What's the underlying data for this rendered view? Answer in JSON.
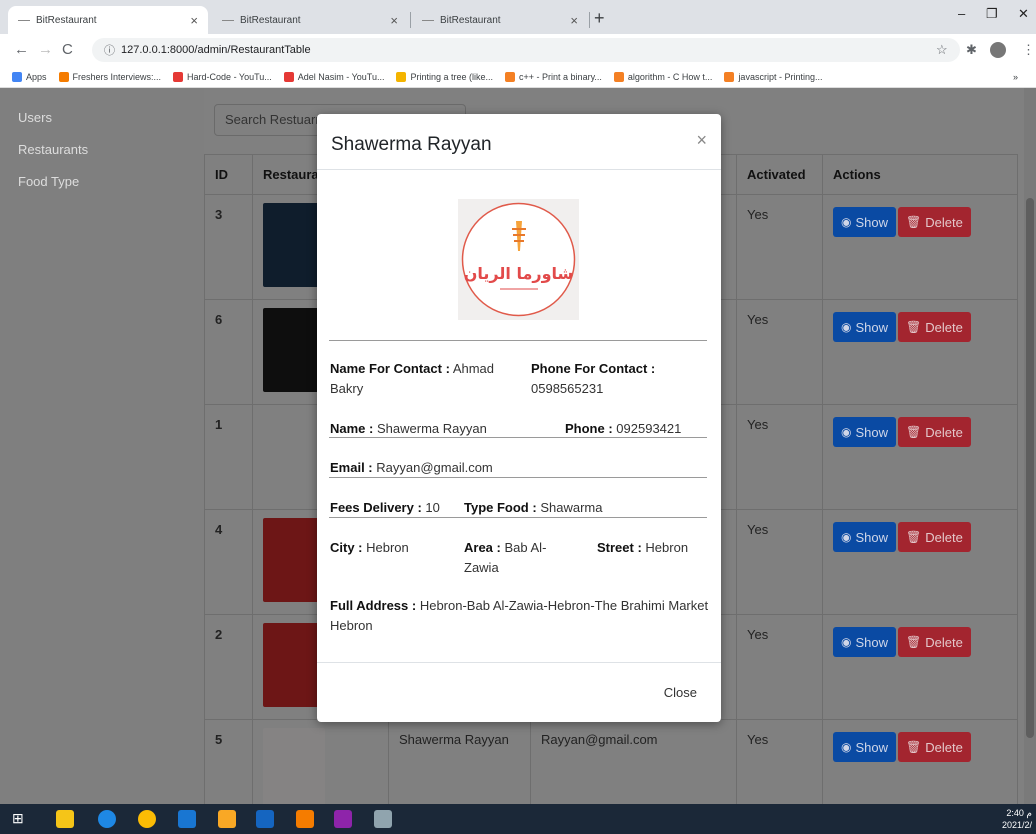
{
  "browser": {
    "tabs": [
      {
        "title": "BitRestaurant",
        "close": "×"
      },
      {
        "title": "BitRestaurant",
        "close": "×"
      },
      {
        "title": "BitRestaurant",
        "close": "×"
      }
    ],
    "new_tab": "+",
    "window_controls": {
      "minimize": "–",
      "restore": "❐",
      "close": "✕"
    },
    "url": "127.0.0.1:8000/admin/RestaurantTable",
    "bookmarks": [
      {
        "label": "Apps",
        "color": "#4285f4"
      },
      {
        "label": "Freshers Interviews:...",
        "color": "#f57c00"
      },
      {
        "label": "Hard-Code - YouTu...",
        "color": "#e53935"
      },
      {
        "label": "Adel Nasim - YouTu...",
        "color": "#e53935"
      },
      {
        "label": "Printing a tree (like...",
        "color": "#f4b400"
      },
      {
        "label": "c++ - Print a binary...",
        "color": "#f48024"
      },
      {
        "label": "algorithm - C How t...",
        "color": "#f48024"
      },
      {
        "label": "javascript - Printing...",
        "color": "#f48024"
      }
    ],
    "bookmarks_more": "»"
  },
  "sidebar": {
    "items": [
      {
        "label": "Users"
      },
      {
        "label": "Restaurants"
      },
      {
        "label": "Food Type"
      }
    ]
  },
  "main": {
    "search_placeholder": "Search Restuarn",
    "columns": [
      "ID",
      "Restaura",
      "Activated",
      "Actions"
    ],
    "rows": [
      {
        "id": "3",
        "activated": "Yes",
        "logo_color": "#1c3550",
        "name": "",
        "email": ""
      },
      {
        "id": "6",
        "activated": "Yes",
        "logo_color": "#1a1a1a",
        "name": "",
        "email": ""
      },
      {
        "id": "1",
        "activated": "Yes",
        "logo_color": "#e8e8e8",
        "name": "",
        "email": ""
      },
      {
        "id": "4",
        "activated": "Yes",
        "logo_color": "#c62828",
        "name": "",
        "email": ""
      },
      {
        "id": "2",
        "activated": "Yes",
        "logo_color": "#c62828",
        "name": "",
        "email": ""
      },
      {
        "id": "5",
        "activated": "Yes",
        "logo_color": "#f1efee",
        "name": "Shawerma Rayyan",
        "email": "Rayyan@gmail.com"
      }
    ],
    "show_label": "Show",
    "delete_label": "Delete"
  },
  "modal": {
    "title": "Shawerma Rayyan",
    "close_x": "×",
    "logo_text": "شاورما الريان",
    "fields": {
      "name_for_contact_label": "Name For Contact :",
      "name_for_contact_value": "Ahmad Bakry",
      "phone_for_contact_label": "Phone For Contact :",
      "phone_for_contact_value": "0598565231",
      "name_label": "Name :",
      "name_value": "Shawerma Rayyan",
      "phone_label": "Phone :",
      "phone_value": "092593421",
      "email_label": "Email :",
      "email_value": "Rayyan@gmail.com",
      "fees_label": "Fees Delivery :",
      "fees_value": "10",
      "type_food_label": "Type Food :",
      "type_food_value": "Shawarma",
      "city_label": "City :",
      "city_value": "Hebron",
      "area_label": "Area :",
      "area_value": "Bab Al-Zawia",
      "street_label": "Street :",
      "street_value": "Hebron",
      "full_address_label": "Full Address :",
      "full_address_value": "Hebron-Bab Al-Zawia-Hebron-The Brahimi Market Hebron"
    },
    "close_button": "Close"
  },
  "taskbar": {
    "time": "2:40 م",
    "date": "2021/2/"
  }
}
